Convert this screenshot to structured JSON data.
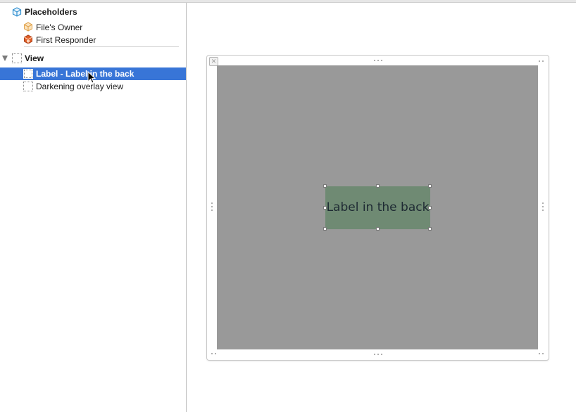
{
  "outline": {
    "placeholders": {
      "title": "Placeholders",
      "items": [
        {
          "label": "File's Owner",
          "icon": "files-owner-cube-icon"
        },
        {
          "label": "First Responder",
          "icon": "first-responder-cube-icon"
        }
      ]
    },
    "view": {
      "title": "View",
      "expanded": true,
      "children": [
        {
          "label": "Label - Label in the back",
          "selected": true
        },
        {
          "label": "Darkening overlay view",
          "selected": false
        }
      ]
    }
  },
  "canvas": {
    "label_text": "Label in the back",
    "view_background": "#999999",
    "label_background": "#6f8a73"
  },
  "colors": {
    "selection": "#3875d7",
    "placeholder_icon": "#2f8fd0",
    "first_responder_icon": "#d9622b"
  }
}
